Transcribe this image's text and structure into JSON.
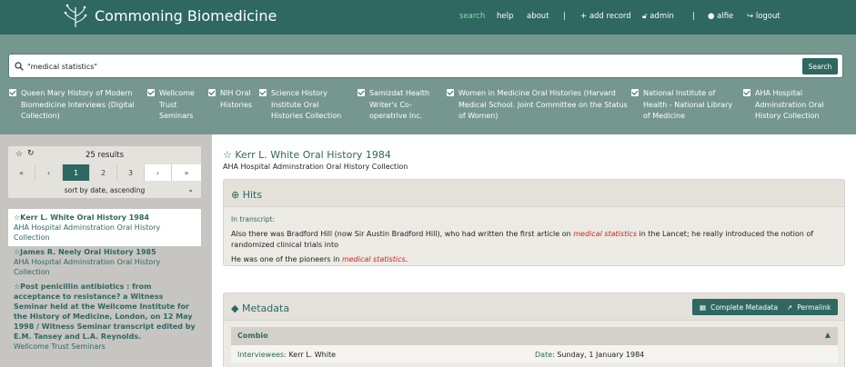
{
  "brand": {
    "name": "Commoning Biomedicine"
  },
  "nav": {
    "search": "search",
    "help": "help",
    "about": "about",
    "sep": "|",
    "add_record": "+ add record",
    "admin": "admin",
    "user": "alfie",
    "logout": "logout"
  },
  "search": {
    "value": "\"medical statistics\"",
    "placeholder": "",
    "button": "Search"
  },
  "collections": [
    {
      "label": "Queen Mary History of Modern Biomedicine Interviews (Digital Collection)",
      "checked": true
    },
    {
      "label": "Wellcome Trust Seminars",
      "checked": true
    },
    {
      "label": "NIH Oral Histories",
      "checked": true
    },
    {
      "label": "Science History Institute Oral Histories Collection",
      "checked": true
    },
    {
      "label": "Samizdat Health Writer's Co-operatrive Inc.",
      "checked": true
    },
    {
      "label": "Women in Medicine Oral Histories (Harvard Medical School. Joint Committee on the Status of Women)",
      "checked": true
    },
    {
      "label": "National Institute of Health - National Library of Medicine",
      "checked": true
    },
    {
      "label": "AHA Hospital Adminstration Oral History Collection",
      "checked": true
    }
  ],
  "results": {
    "count": "25 results",
    "pages": [
      "«",
      "‹",
      "1",
      "2",
      "3",
      "›",
      "»"
    ],
    "current_page": "1",
    "sort": "sort by date, ascending",
    "items": [
      {
        "title": "Kerr L. White Oral History 1984",
        "collection": "AHA Hospital Adminstration Oral History Collection"
      },
      {
        "title": "James R. Neely Oral History 1985",
        "collection": "AHA Hospital Adminstration Oral History Collection"
      },
      {
        "title": "Post penicillin antibiotics : from acceptance to resistance? a Witness Seminar held at the Wellcome Institute for the History of Medicine, London, on 12 May 1998 / Witness Seminar transcript edited by E.M. Tansey and L.A. Reynolds.",
        "collection": "Wellcome Trust Seminars"
      }
    ]
  },
  "record": {
    "title": "Kerr L. White Oral History 1984",
    "collection": "AHA Hospital Adminstration Oral History Collection",
    "hits": {
      "header": "Hits",
      "label": "In transcript:",
      "line1_pre": "Also there was Bradford Hill (now Sir Austin Bradford Hill), who had written the first article on ",
      "line1_hl": "medical statistics",
      "line1_post": " in the Lancet; he really introduced the notion of randomized clinical trials into",
      "line2_pre": "He was one of the pioneers in ",
      "line2_hl": "medical statistics",
      "line2_post": "."
    },
    "metadata": {
      "header": "Metadata",
      "complete_btn": "Complete Metadata",
      "permalink_btn": "Permalink",
      "section": "Combio",
      "interviewees_label": "Interviewees:",
      "interviewees_value": "Kerr L. White",
      "date_label": "Date:",
      "date_value": "Sunday, 1 January 1984"
    }
  },
  "colors": {
    "primary": "#2e6860",
    "active_nav": "#7fe3a6",
    "highlight": "#d42121"
  }
}
